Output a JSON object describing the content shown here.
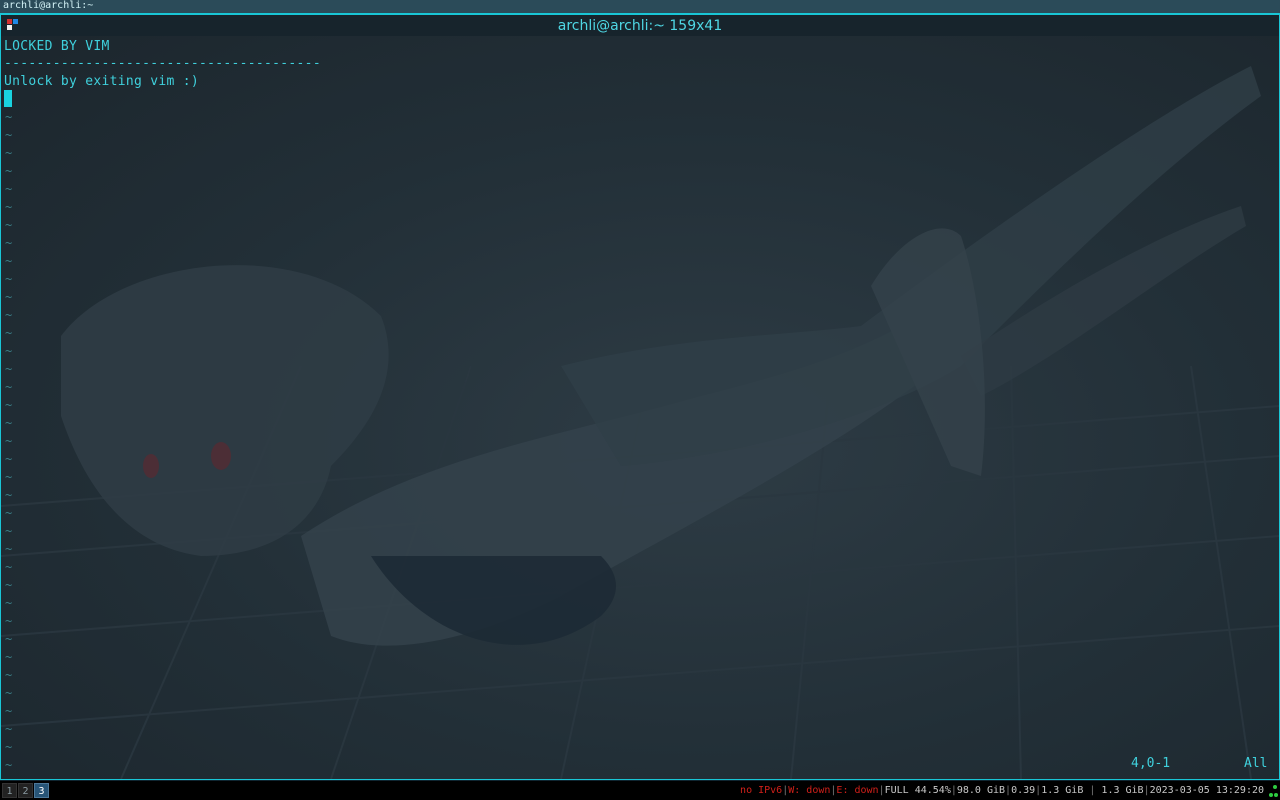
{
  "i3_title": "archli@archli:~",
  "terminal": {
    "title": "archli@archli:~ 159x41"
  },
  "vim": {
    "lines": [
      "LOCKED BY VIM",
      "---------------------------------------",
      "Unlock by exiting vim :)"
    ],
    "tilde": "~",
    "ruler_position": "4,0-1",
    "ruler_scroll": "All"
  },
  "bar": {
    "workspaces": [
      "1",
      "2",
      "3"
    ],
    "focused_workspace": "3",
    "status": {
      "ipv6": "no IPv6",
      "wireless": "W: down",
      "ethernet": "E: down",
      "battery": "FULL 44.54%",
      "disk": "98.0 GiB",
      "load": "0.39",
      "memory": "1.3 GiB",
      "memory2": "1.3 GiB",
      "datetime": "2023-03-05 13:29:20"
    }
  },
  "colors": {
    "accent": "#19c6d6",
    "text": "#3fd0dc",
    "status_bad": "#d0201a",
    "focused_ws": "#285577"
  }
}
